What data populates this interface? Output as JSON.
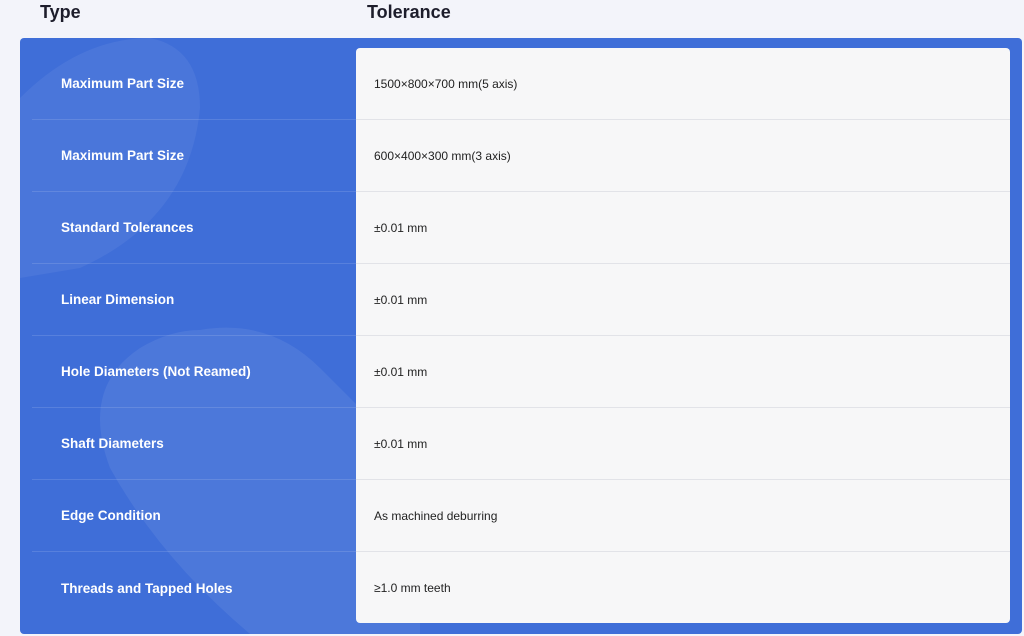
{
  "header": {
    "type_label": "Type",
    "tolerance_label": "Tolerance"
  },
  "rows": [
    {
      "type": "Maximum Part Size",
      "tolerance": "1500×800×700 mm(5 axis)"
    },
    {
      "type": "Maximum Part Size",
      "tolerance": "600×400×300 mm(3 axis)"
    },
    {
      "type": "Standard Tolerances",
      "tolerance": "±0.01 mm"
    },
    {
      "type": "Linear Dimension",
      "tolerance": "±0.01 mm"
    },
    {
      "type": "Hole Diameters (Not Reamed)",
      "tolerance": "±0.01 mm"
    },
    {
      "type": "Shaft Diameters",
      "tolerance": "±0.01 mm"
    },
    {
      "type": "Edge Condition",
      "tolerance": "As machined deburring"
    },
    {
      "type": "Threads and Tapped Holes",
      "tolerance": "≥1.0 mm teeth"
    }
  ],
  "colors": {
    "panel": "#3f6ed8",
    "card": "#f7f7f8",
    "page_bg": "#f3f4fa"
  }
}
